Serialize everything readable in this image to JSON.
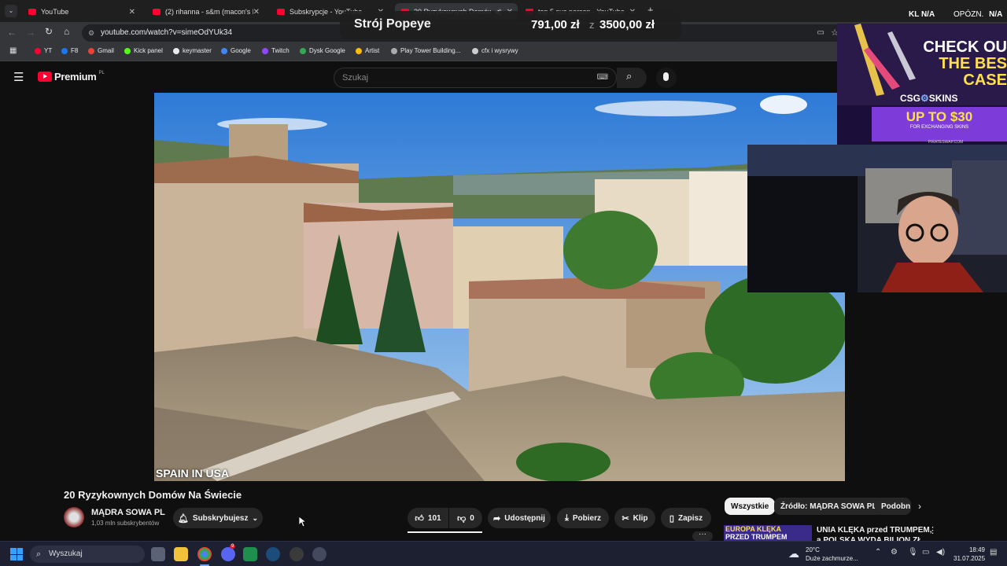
{
  "browser": {
    "tabs": [
      {
        "label": "YouTube"
      },
      {
        "label": "(2) rihanna - s&m (macon's HY"
      },
      {
        "label": "Subskrypcje - YouTube"
      },
      {
        "label": "20 Ryzykownych Domów N"
      },
      {
        "label": "top 5 sus person - YouTube"
      }
    ],
    "new_tab": "+",
    "url": "youtube.com/watch?v=simeOdYUk34",
    "bookmarks": [
      {
        "label": "YT",
        "color": "#ff0033"
      },
      {
        "label": "F8",
        "color": "#1877f2"
      },
      {
        "label": "Gmail",
        "color": "#ea4335"
      },
      {
        "label": "Kick panel",
        "color": "#53fc18"
      },
      {
        "label": "keymaster",
        "color": "#e8eaed"
      },
      {
        "label": "Google",
        "color": "#4285f4"
      },
      {
        "label": "Twitch",
        "color": "#9146ff"
      },
      {
        "label": "Dysk Google",
        "color": "#34a853"
      },
      {
        "label": "Artist",
        "color": "#fbbc04"
      },
      {
        "label": "Play Tower Building...",
        "color": "#aaaaaa"
      },
      {
        "label": "cfx i wysrywy",
        "color": "#cccccc"
      }
    ]
  },
  "youtube": {
    "logo_text": "Premium",
    "logo_region": "PL",
    "search_placeholder": "Szukaj",
    "video_caption": "SPAIN IN USA",
    "video_title": "20 Ryzykownych Domów Na Świecie",
    "channel_name": "MĄDRA SOWA PL",
    "subscribers": "1,03 mln subskrybentów",
    "subscribe_label": "Subskrybujesz",
    "likes": "101",
    "dislikes": "0",
    "share_label": "Udostępnij",
    "download_label": "Pobierz",
    "clip_label": "Klip",
    "save_label": "Zapisz",
    "chips": [
      "Wszystkie",
      "Źródło: MĄDRA SOWA PL",
      "Podobn"
    ],
    "rec_thumb_text_1": "EUROPA KLĘKA",
    "rec_thumb_text_2": "PRZED TRUMPEM",
    "rec_title_1": "UNIA KLĘKA przed TRUMPEM,",
    "rec_title_2": "a POLSKA WYDA BILION ZŁ"
  },
  "stream_overlay": {
    "item_label": "Strój Popeye",
    "price_current": "791,00 zł",
    "price_separator": "z",
    "price_target": "3500,00 zł",
    "top_right_left": "KL",
    "top_right_left_value": "N/A",
    "top_right_right": "OPÓZN.",
    "top_right_right_value": "N/A"
  },
  "ad": {
    "headline_1": "CHECK OU",
    "headline_2": "THE BES",
    "headline_3": "CASE",
    "brand": "CSG",
    "brand_suffix": "SKINS",
    "promo": "UP TO $30",
    "promo_sub": "FOR EXCHANGING SKINS",
    "footer": "PIRATESWAP.COM"
  },
  "taskbar": {
    "search_placeholder": "Wyszukaj",
    "weather_temp": "20°C",
    "weather_desc": "Duże zachmurze...",
    "time": "18:49",
    "date": "31.07.2025",
    "discord_badge": "9"
  }
}
